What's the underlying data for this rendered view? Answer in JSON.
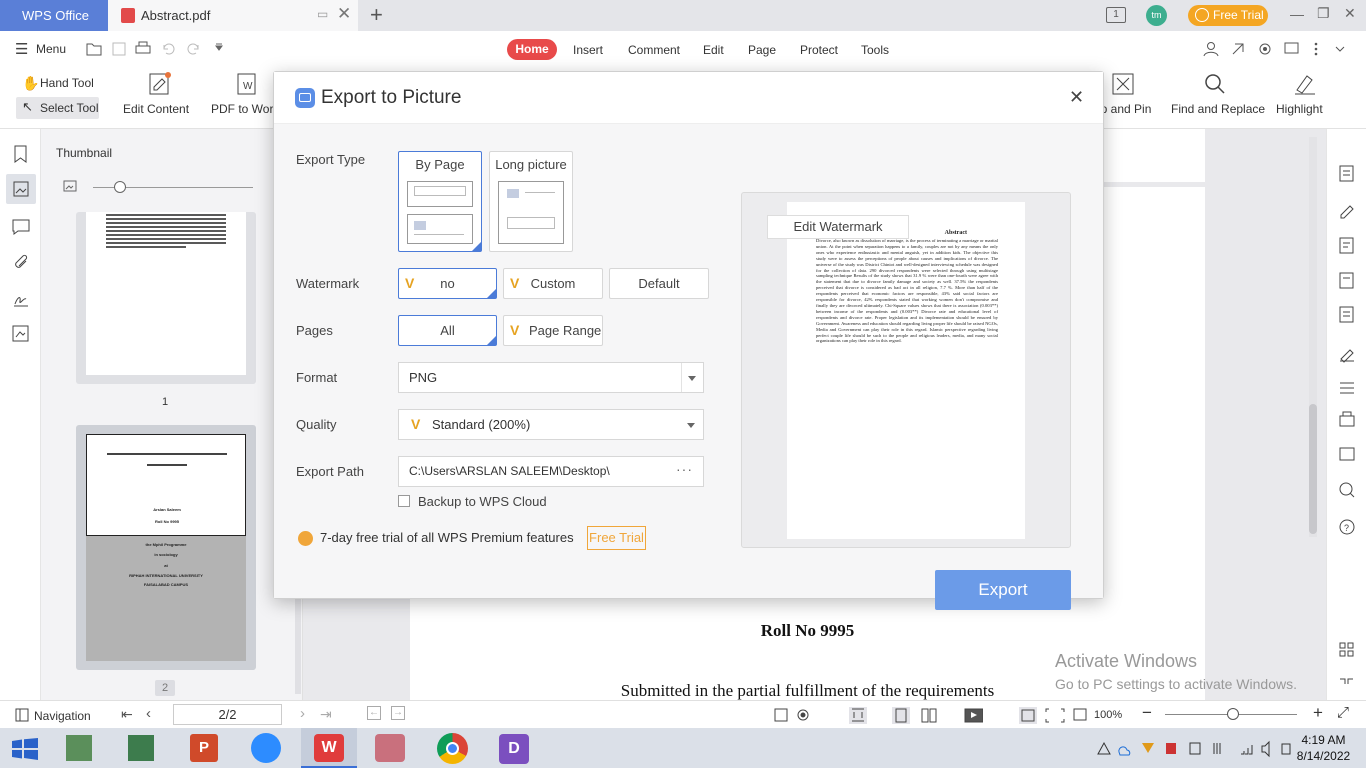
{
  "titlebar": {
    "app_tab": "WPS Office",
    "doc_tab": "Abstract.pdf",
    "free_trial": "Free Trial",
    "avatar": "tm",
    "page_count_badge": "1"
  },
  "menu": {
    "menu_label": "Menu",
    "tabs": [
      "Home",
      "Insert",
      "Comment",
      "Edit",
      "Page",
      "Protect",
      "Tools"
    ]
  },
  "toolbar": {
    "hand_tool": "Hand Tool",
    "select_tool": "Select Tool",
    "edit_content": "Edit Content",
    "pdf_to_word": "PDF to Word",
    "clip_and_pin": "ip and Pin",
    "find_replace": "Find and Replace",
    "highlight": "Highlight"
  },
  "thumbnail": {
    "title": "Thumbnail",
    "page1_number": "1",
    "page2_number": "2",
    "page2_lines": [
      "Arslan Saleem",
      "Roll No 9995",
      "the Mphil Programme",
      "in sociology",
      "at",
      "RIPHAH INTERNATIONAL UNIVERSITY",
      "FAISALABAD CAMPUS"
    ]
  },
  "document": {
    "roll_no": "Roll No 9995",
    "submitted": "Submitted in the partial fulfillment of the requirements",
    "watermark_title": "Activate Windows",
    "watermark_sub": "Go to PC settings to activate Windows."
  },
  "statusbar": {
    "navigation": "Navigation",
    "page_indicator": "2/2",
    "zoom": "100%"
  },
  "taskbar": {
    "time": "4:19 AM",
    "date": "8/14/2022"
  },
  "dialog": {
    "title": "Export to Picture",
    "export_type_label": "Export Type",
    "by_page": "By Page",
    "long_picture": "Long picture",
    "watermark_label": "Watermark",
    "watermark_options": [
      "no",
      "Custom",
      "Default"
    ],
    "pages_label": "Pages",
    "pages_all": "All",
    "pages_range": "Page Range",
    "format_label": "Format",
    "format_value": "PNG",
    "quality_label": "Quality",
    "quality_value": "Standard (200%)",
    "export_path_label": "Export Path",
    "export_path_value": "C:\\Users\\ARSLAN SALEEM\\Desktop\\",
    "backup_label": "Backup to WPS Cloud",
    "trial_text": "7-day free trial of all WPS Premium features",
    "trial_button": "Free Trial",
    "edit_watermark": "Edit Watermark",
    "export_button": "Export",
    "preview_heading": "Abstract",
    "preview_text": "Divorce, also known as dissolution of marriage, is the process of terminating a marriage or marital union. At the point when separation happens to a family, couples are not by any means the only ones who experience enthusiastic and mental anguish, yet in addition kids. The objective this study were to assess the perceptions of people about causes and implications of divorce. The universe of the study was District Chiniot and well-designed interviewing schedule was designed for the collection of data. 290 divorced respondents were selected through using multistage sampling technique Results of the study shows that 31.9 % were than one-fourth were agree with the statement that due to divorce family damage and society as well. 37.5% the respondents perceived that divorce is considered as bad act in all religion, 7.7 %. More than half of the respondents perceived that economic factors are responsible, 43% said social factors are responsible for divorce, 42% respondents stated that working women don't compromise and finally they are divorced ultimately. Chi-Square values shows that there is association (0.003**) between income of the respondents and (0.003**) Divorce rate and educational level of respondents and divorce rate. Proper legislation and its implementation should be ensured by Government. Awareness and education should regarding living proper life should be raised NGOs, Media and Government can play their role in this regard. Islamic perspective regarding living perfect couple life should be such to the people and religious leaders, media, and many social organizations can play their role in this regard."
  },
  "colors": {
    "accent": "#4b7bd8",
    "home_tab": "#e84a4a",
    "trial": "#f4a623",
    "export_button": "#6b9be8"
  }
}
